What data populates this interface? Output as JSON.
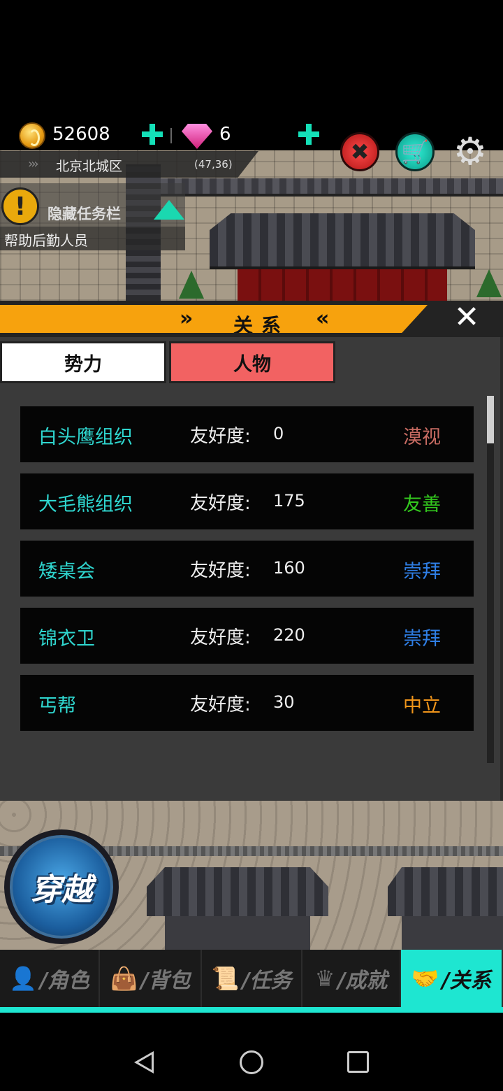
{
  "hud": {
    "gold": "52608",
    "gems": "6",
    "location": "北京北城区",
    "coords": "(47,36)"
  },
  "quest": {
    "title": "隐藏任务栏",
    "item": "帮助后勤人员"
  },
  "dialog": {
    "title": "关系",
    "title_left_arrows": "»",
    "title_right_arrows": "«",
    "close_glyph": "✕",
    "tabs": [
      {
        "label": "势力"
      },
      {
        "label": "人物"
      }
    ],
    "rows": [
      {
        "name": "白头鹰组织",
        "label": "友好度:",
        "value": "0",
        "status": "漠视",
        "status_color": "#c76b62"
      },
      {
        "name": "大毛熊组织",
        "label": "友好度:",
        "value": "175",
        "status": "友善",
        "status_color": "#33c81e"
      },
      {
        "name": "矮桌会",
        "label": "友好度:",
        "value": "160",
        "status": "崇拜",
        "status_color": "#2f7fe6"
      },
      {
        "name": "锦衣卫",
        "label": "友好度:",
        "value": "220",
        "status": "崇拜",
        "status_color": "#2f7fe6"
      },
      {
        "name": "丐帮",
        "label": "友好度:",
        "value": "30",
        "status": "中立",
        "status_color": "#f0951a"
      }
    ]
  },
  "warp_button": "穿越",
  "nav": {
    "items": [
      {
        "label": "/角色",
        "icon": "person-icon"
      },
      {
        "label": "/背包",
        "icon": "bag-icon"
      },
      {
        "label": "/任务",
        "icon": "scroll-icon"
      },
      {
        "label": "/成就",
        "icon": "crown-icon"
      },
      {
        "label": "/关系",
        "icon": "handshake-icon"
      }
    ],
    "active_index": 4
  },
  "colors": {
    "accent_teal": "#1ee6d1",
    "title_orange": "#f7a20d",
    "tab_active": "#f26262",
    "name_teal": "#2fd6cf"
  }
}
